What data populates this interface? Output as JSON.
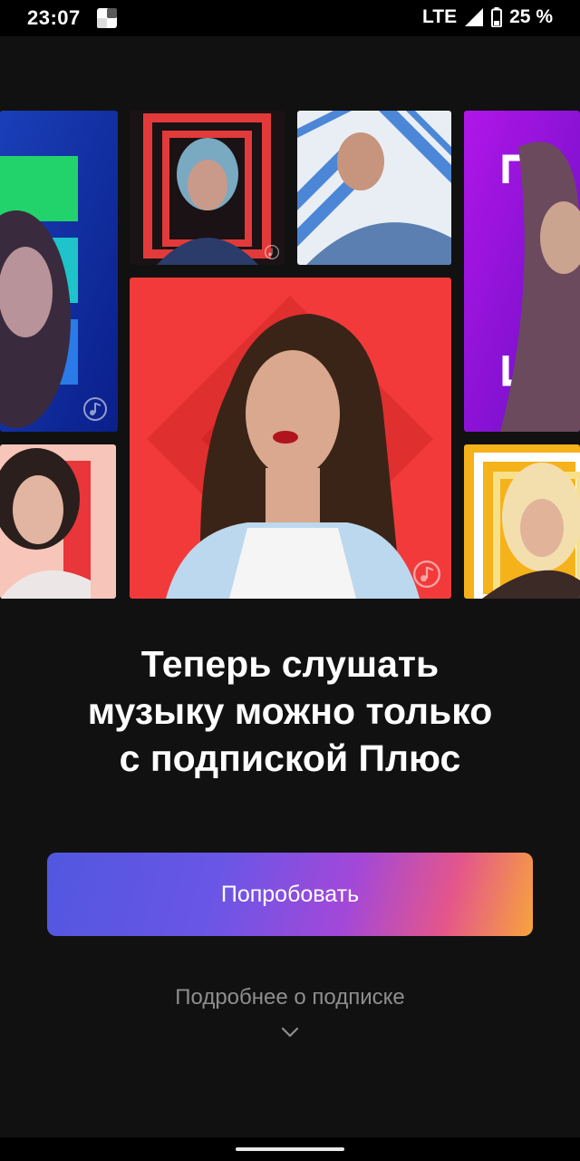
{
  "status_bar": {
    "time": "23:07",
    "network": "LTE",
    "battery": "25 %",
    "icons": [
      "app-notification-icon",
      "signal-icon",
      "battery-icon"
    ]
  },
  "collage": {
    "tiles": [
      {
        "name": "artist-tile-green-blue",
        "icon": "music-note-icon",
        "accent": "#1f5ae0"
      },
      {
        "name": "artist-tile-red-frame",
        "icon": "music-note-icon",
        "accent": "#e23a3a"
      },
      {
        "name": "artist-tile-chevron",
        "icon": "music-note-icon",
        "accent": "#3f7fd6"
      },
      {
        "name": "artist-tile-purple",
        "icon": "music-note-icon",
        "accent": "#8a1fd6"
      },
      {
        "name": "artist-tile-featured-red",
        "icon": "music-note-icon",
        "accent": "#f23a3a"
      },
      {
        "name": "artist-tile-pink",
        "icon": "music-note-icon",
        "accent": "#f6b3a8"
      },
      {
        "name": "artist-tile-yellow",
        "icon": "music-note-icon",
        "accent": "#f5b21a"
      }
    ]
  },
  "headline": {
    "lines": [
      "Теперь слушать",
      "музыку можно только",
      "с подпиской Плюс"
    ]
  },
  "cta": {
    "label": "Попробовать"
  },
  "more": {
    "label": "Подробнее о подписке",
    "icon": "chevron-down-icon"
  },
  "colors": {
    "background": "#111111",
    "gradient_start": "#5157e0",
    "gradient_mid": "#a348d8",
    "gradient_end": "#f7a43c",
    "secondary_text": "#8e8e8e"
  }
}
